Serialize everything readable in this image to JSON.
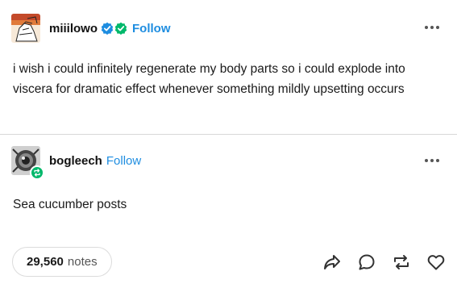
{
  "original_post": {
    "username": "miiilowo",
    "follow_label": "Follow",
    "text": "i wish i could infinitely regenerate my body parts so i could explode into viscera for dramatic effect whenever something mildly upsetting occurs"
  },
  "reblog": {
    "username": "bogleech",
    "follow_label": "Follow",
    "text": "Sea cucumber posts"
  },
  "footer": {
    "notes_count": "29,560",
    "notes_label": "notes"
  },
  "icons": {
    "verified": "blue-check-badge-icon",
    "verified_secondary": "green-check-badge-icon",
    "more": "more-options-icon",
    "share": "share-icon",
    "reply": "reply-icon",
    "reblog": "reblog-icon",
    "like": "heart-icon"
  },
  "colors": {
    "follow": "#1e8de0",
    "verified_blue": "#1e8de0",
    "verified_green": "#00b86b"
  }
}
